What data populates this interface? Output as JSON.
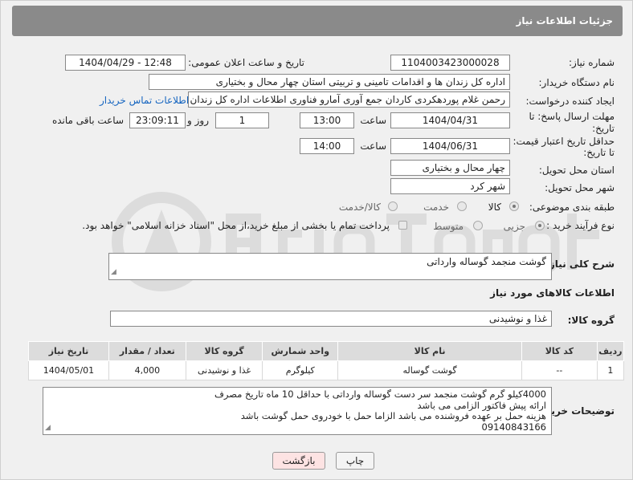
{
  "header": {
    "title": "جزئیات اطلاعات نیاز"
  },
  "fields": {
    "need_number_label": "شماره نیاز:",
    "need_number": "1104003423000028",
    "announce_label": "تاریخ و ساعت اعلان عمومی:",
    "announce_value": "1404/04/29 - 12:48",
    "buyer_label": "نام دستگاه خریدار:",
    "buyer_value": "اداره کل زندان ها و اقدامات تامینی و تربیتی استان چهار محال و بختیاری",
    "creator_label": "ایجاد کننده درخواست:",
    "creator_value": "رحمن غلام پوردهکردی کاردان جمع آوری آمارو فناوری اطلاعات اداره کل زندان ها",
    "contact_link": "اطلاعات تماس خریدار",
    "deadline_label_1": "مهلت ارسال پاسخ: تا",
    "deadline_label_2": "تاریخ:",
    "deadline_date": "1404/04/31",
    "time_label": "ساعت",
    "deadline_time": "13:00",
    "days_value": "1",
    "days_label": "روز و",
    "remaining_time": "23:09:11",
    "remaining_label": "ساعت باقی مانده",
    "validity_label_1": "حداقل تاریخ اعتبار قیمت:",
    "validity_label_2": "تا تاریخ:",
    "validity_date": "1404/06/31",
    "validity_time": "14:00",
    "province_label": "استان محل تحویل:",
    "province_value": "چهار محال و بختیاری",
    "city_label": "شهر محل تحویل:",
    "city_value": "شهر کرد",
    "category_label": "طبقه بندی موضوعی:",
    "category_options": [
      "کالا",
      "خدمت",
      "کالا/خدمت"
    ],
    "process_label": "نوع فرآیند خرید :",
    "process_options": [
      "جزیی",
      "متوسط"
    ],
    "payment_note": "پرداخت تمام یا بخشی از مبلغ خرید،از محل \"اسناد خزانه اسلامی\" خواهد بود."
  },
  "summary": {
    "label": "شرح کلی نیاز:",
    "value": "گوشت منجمد گوساله وارداتی"
  },
  "goods": {
    "section_title": "اطلاعات کالاهای مورد نیاز",
    "group_label": "گروه کالا:",
    "group_value": "غذا و نوشیدنی",
    "columns": [
      "ردیف",
      "کد کالا",
      "نام کالا",
      "واحد شمارش",
      "گروه کالا",
      "تعداد / مقدار",
      "تاریخ نیاز"
    ],
    "rows": [
      [
        "1",
        "--",
        "گوشت گوساله",
        "کیلوگرم",
        "غذا و نوشیدنی",
        "4,000",
        "1404/05/01"
      ]
    ]
  },
  "buyer_notes": {
    "label": "توضیحات خریدار:",
    "lines": [
      "4000کیلو گرم گوشت منجمد سر دست گوساله وارداتی با حداقل 10 ماه تاریخ مصرف",
      "ارائه پیش فاکتور الزامی می باشد",
      "هزینه حمل بر عهده فروشنده می باشد الزاما حمل با خودروی حمل گوشت باشد",
      "09140843166"
    ]
  },
  "buttons": {
    "print": "چاپ",
    "back": "بازگشت"
  }
}
